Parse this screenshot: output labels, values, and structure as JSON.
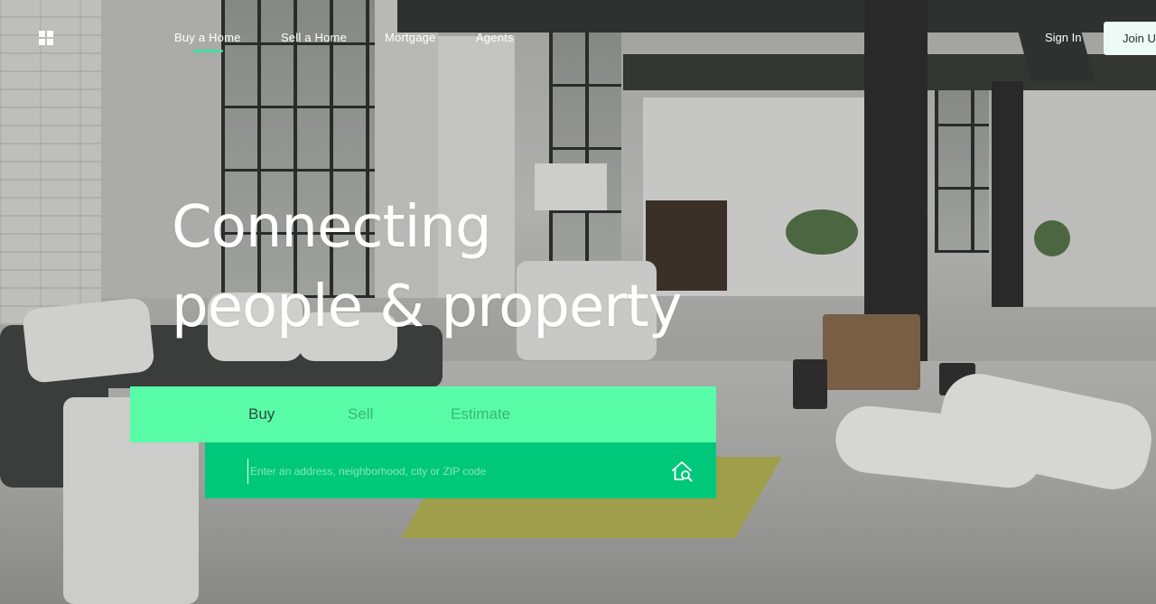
{
  "nav": {
    "links": [
      {
        "label": "Buy  a Home"
      },
      {
        "label": "Sell  a Home"
      },
      {
        "label": "Mortgage"
      },
      {
        "label": "Agents"
      }
    ],
    "active_index": 0,
    "sign_in": "Sign In",
    "join": "Join Us"
  },
  "hero": {
    "headline_line1": "Connecting",
    "headline_line2": "people & property"
  },
  "search": {
    "tabs": [
      {
        "label": "Buy"
      },
      {
        "label": "Sell"
      },
      {
        "label": "Estimate"
      }
    ],
    "active_tab": "Buy",
    "placeholder": "Enter an address, neighborhood, city or ZIP code",
    "value": ""
  },
  "icons": {
    "logo": "grid-logo-icon",
    "search": "home-search-icon"
  },
  "colors": {
    "accent": "#3fe09a",
    "tabs_bg": "#58fca7",
    "search_bg": "#00c87a",
    "join_bg": "#ecfbf6"
  }
}
